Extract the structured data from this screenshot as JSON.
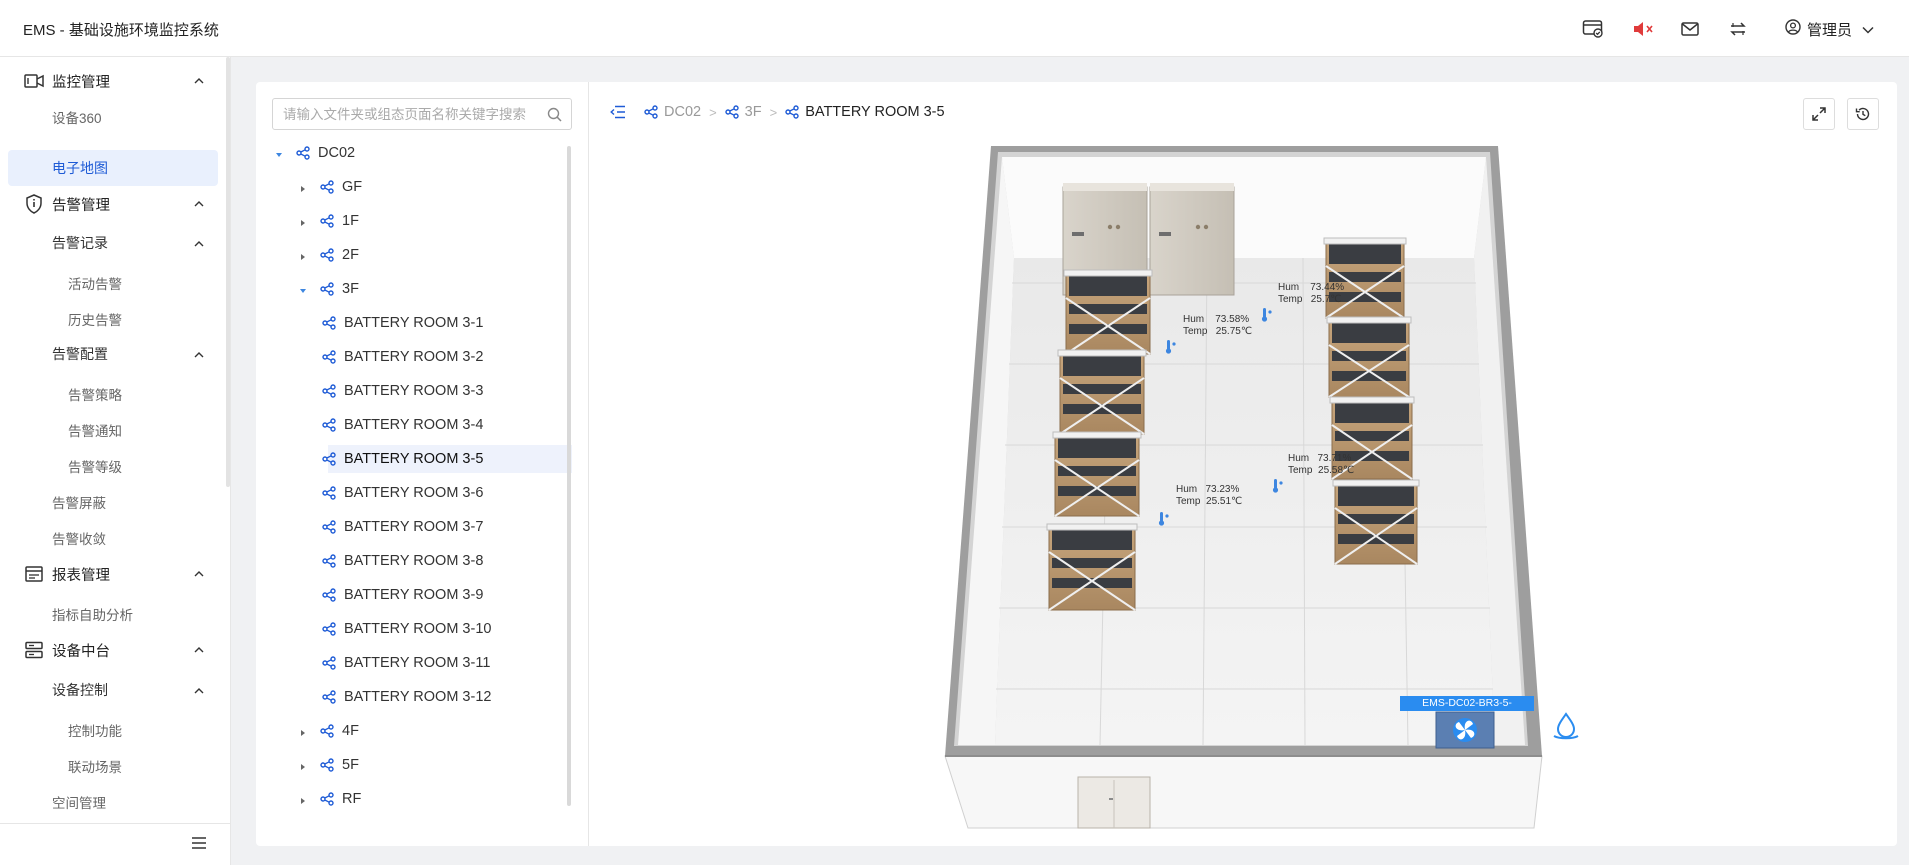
{
  "header": {
    "app_title": "EMS - 基础设施环境监控系统",
    "icons": [
      "monitor-check-icon",
      "speaker-mute-icon",
      "mail-icon",
      "swap-icon",
      "user-circle-icon"
    ],
    "user_name": "管理员"
  },
  "sidebar": {
    "groups": [
      {
        "label": "监控管理",
        "icon": "video-camera-icon",
        "expanded": true
      },
      {
        "label": "设备360"
      },
      {
        "label": "电子地图",
        "active": true
      },
      {
        "label": "告警管理",
        "icon": "shield-info-icon",
        "expanded": true
      },
      {
        "label": "告警记录",
        "expanded": true
      },
      {
        "label": "活动告警"
      },
      {
        "label": "历史告警"
      },
      {
        "label": "告警配置",
        "expanded": true
      },
      {
        "label": "告警策略"
      },
      {
        "label": "告警通知"
      },
      {
        "label": "告警等级"
      },
      {
        "label": "告警屏蔽"
      },
      {
        "label": "告警收敛"
      },
      {
        "label": "报表管理",
        "icon": "report-icon",
        "expanded": true
      },
      {
        "label": "指标自助分析"
      },
      {
        "label": "设备中台",
        "icon": "server-icon",
        "expanded": true
      },
      {
        "label": "设备控制",
        "expanded": true
      },
      {
        "label": "控制功能"
      },
      {
        "label": "联动场景"
      },
      {
        "label": "空间管理"
      }
    ]
  },
  "tree": {
    "search_placeholder": "请输入文件夹或组态页面名称关键字搜索",
    "nodes": [
      {
        "label": "DC02",
        "level": 0,
        "expanded": true
      },
      {
        "label": "GF",
        "level": 1,
        "expanded": false
      },
      {
        "label": "1F",
        "level": 1,
        "expanded": false
      },
      {
        "label": "2F",
        "level": 1,
        "expanded": false
      },
      {
        "label": "3F",
        "level": 1,
        "expanded": true
      },
      {
        "label": "BATTERY ROOM 3-1",
        "level": 2
      },
      {
        "label": "BATTERY ROOM 3-2",
        "level": 2
      },
      {
        "label": "BATTERY ROOM 3-3",
        "level": 2
      },
      {
        "label": "BATTERY ROOM 3-4",
        "level": 2
      },
      {
        "label": "BATTERY ROOM 3-5",
        "level": 2,
        "selected": true
      },
      {
        "label": "BATTERY ROOM 3-6",
        "level": 2
      },
      {
        "label": "BATTERY ROOM 3-7",
        "level": 2
      },
      {
        "label": "BATTERY ROOM 3-8",
        "level": 2
      },
      {
        "label": "BATTERY ROOM 3-9",
        "level": 2
      },
      {
        "label": "BATTERY ROOM 3-10",
        "level": 2
      },
      {
        "label": "BATTERY ROOM 3-11",
        "level": 2
      },
      {
        "label": "BATTERY ROOM 3-12",
        "level": 2
      },
      {
        "label": "4F",
        "level": 1,
        "expanded": false
      },
      {
        "label": "5F",
        "level": 1,
        "expanded": false
      },
      {
        "label": "RF",
        "level": 1,
        "expanded": false
      }
    ]
  },
  "breadcrumb": {
    "items": [
      "DC02",
      "3F",
      "BATTERY ROOM 3-5"
    ]
  },
  "toolbar": {
    "icons": [
      "fullscreen-icon",
      "history-icon"
    ]
  },
  "sensors": [
    {
      "hum_label": "Hum",
      "hum": "73.58%",
      "temp_label": "Temp",
      "temp": "25.75℃"
    },
    {
      "hum_label": "Hum",
      "hum": "73.44%",
      "temp_label": "Temp",
      "temp": "25.7℃"
    },
    {
      "hum_label": "Hum",
      "hum": "73.23%",
      "temp_label": "Temp",
      "temp": "25.51℃"
    },
    {
      "hum_label": "Hum",
      "hum": "73.71%",
      "temp_label": "Temp",
      "temp": "25.58℃"
    }
  ],
  "device_tag": "EMS-DC02-BR3-5-",
  "colors": {
    "accent": "#1e5bd6",
    "active_bg": "#e9f0fd",
    "device_tag": "#2a8cf0",
    "mute_red": "#e03b3b"
  }
}
